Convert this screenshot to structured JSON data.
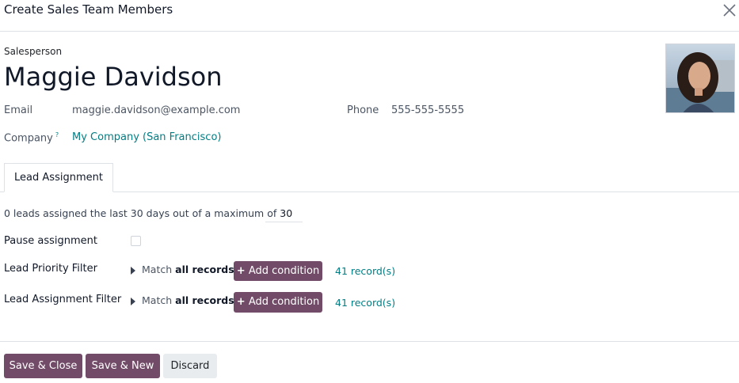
{
  "dialog": {
    "title": "Create Sales Team Members"
  },
  "record": {
    "role_label": "Salesperson",
    "name": "Maggie Davidson",
    "email_label": "Email",
    "email": "maggie.davidson@example.com",
    "phone_label": "Phone",
    "phone": "555-555-5555",
    "company_label": "Company",
    "company_help": "?",
    "company": "My Company (San Francisco)"
  },
  "tabs": [
    {
      "label": "Lead Assignment"
    }
  ],
  "assignment": {
    "summary_prefix": "0 leads assigned the last 30 days out of a maximum of",
    "max_value": "30",
    "pause_label": "Pause assignment",
    "priority_label": "Lead Priority Filter",
    "assignment_label": "Lead Assignment Filter",
    "match_text": "Match",
    "match_bold": "all records",
    "add_condition": "Add condition",
    "add_icon": "plus-icon",
    "records_link": "41 record(s)"
  },
  "footer": {
    "save_close": "Save & Close",
    "save_new": "Save & New",
    "discard": "Discard"
  },
  "colors": {
    "primary": "#714b67",
    "link": "#017e84",
    "secondary": "#e9ecef"
  }
}
